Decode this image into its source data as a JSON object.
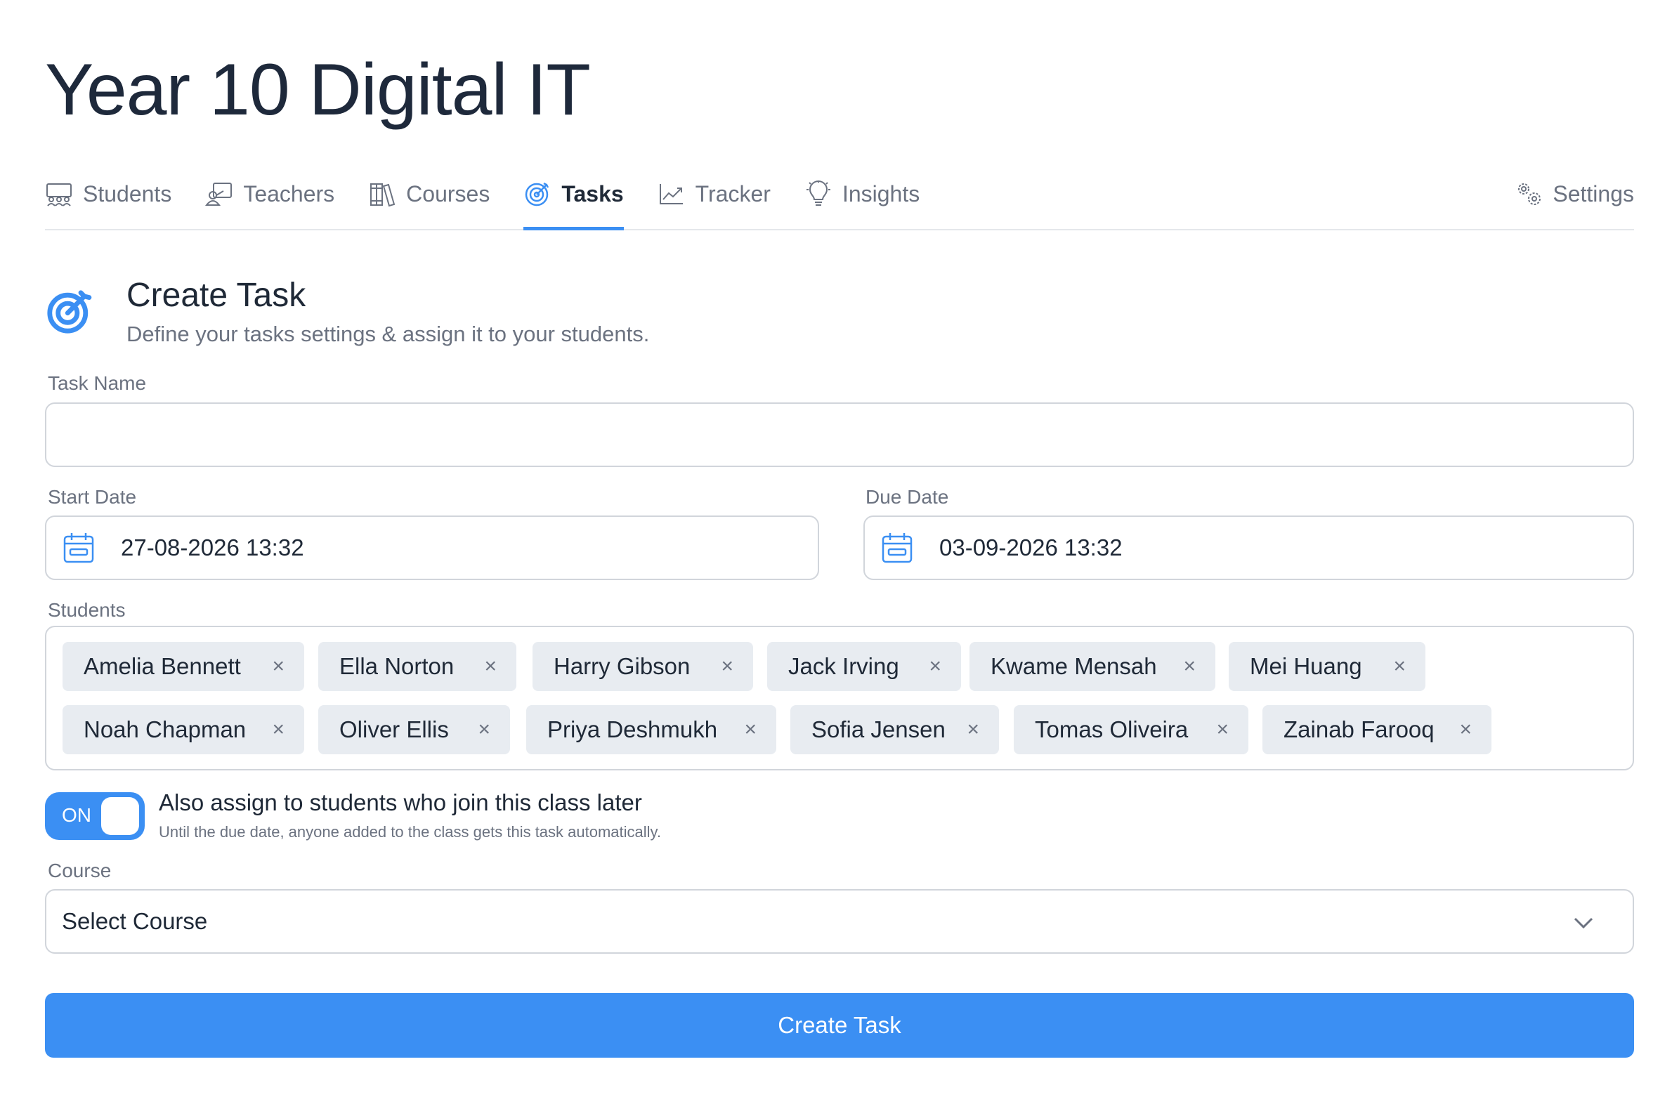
{
  "page": {
    "title": "Year 10 Digital IT"
  },
  "tabs": [
    {
      "label": "Students",
      "icon": "students-icon"
    },
    {
      "label": "Teachers",
      "icon": "teacher-icon"
    },
    {
      "label": "Courses",
      "icon": "books-icon"
    },
    {
      "label": "Tasks",
      "icon": "target-icon",
      "active": true
    },
    {
      "label": "Tracker",
      "icon": "chart-line-icon"
    },
    {
      "label": "Insights",
      "icon": "lightbulb-icon"
    },
    {
      "label": "Settings",
      "icon": "gears-icon"
    }
  ],
  "form": {
    "title": "Create Task",
    "subtitle": "Define your tasks settings & assign it to your students.",
    "task_name": {
      "label": "Task Name",
      "value": ""
    },
    "start_date": {
      "label": "Start Date",
      "value": "27-08-2026 13:32"
    },
    "due_date": {
      "label": "Due Date",
      "value": "03-09-2026 13:32"
    },
    "students": {
      "label": "Students",
      "selected": [
        "Amelia Bennett",
        "Ella Norton",
        "Harry Gibson",
        "Jack Irving",
        "Kwame Mensah",
        "Mei Huang",
        "Noah Chapman",
        "Oliver Ellis",
        "Priya Deshmukh",
        "Sofia Jensen",
        "Tomas Oliveira",
        "Zainab Farooq"
      ],
      "remove_glyph": "×"
    },
    "auto_assign": {
      "state_label": "ON",
      "enabled": true,
      "title": "Also assign to students who join this class later",
      "help": "Until the due date, anyone added to the class gets this task automatically."
    },
    "course": {
      "label": "Course",
      "value": "Select Course"
    },
    "submit_label": "Create Task"
  },
  "colors": {
    "accent": "#3b8ff3",
    "chip_bg": "#e8ecf1",
    "border": "#d1d5db"
  }
}
